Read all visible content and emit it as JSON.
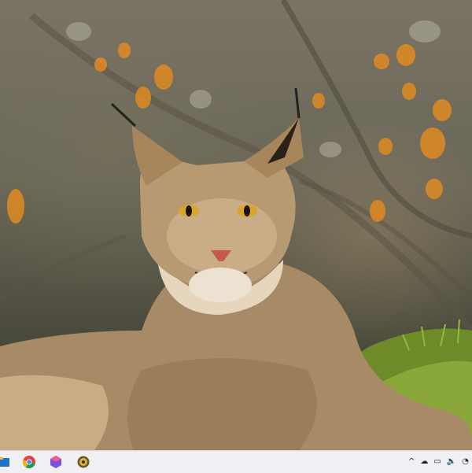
{
  "wallpaper": {
    "subject": "lynx",
    "name": "desktop-wallpaper"
  },
  "taskbar": {
    "pinned_apps": [
      {
        "name": "file-explorer-icon"
      },
      {
        "name": "chrome-icon"
      },
      {
        "name": "app-hexagon-icon"
      },
      {
        "name": "app-round-icon"
      }
    ],
    "tray": [
      {
        "name": "chevron-up-icon",
        "glyph": "^"
      },
      {
        "name": "cloud-icon",
        "glyph": "☁"
      },
      {
        "name": "battery-icon",
        "glyph": "▭"
      },
      {
        "name": "volume-icon",
        "glyph": "🔈"
      },
      {
        "name": "network-icon",
        "glyph": "◔"
      }
    ]
  },
  "colors": {
    "taskbar_bg": "#eef0f3",
    "fur": "#b89a72",
    "grass": "#7d9a2e",
    "bokeh": "#e08a22"
  }
}
